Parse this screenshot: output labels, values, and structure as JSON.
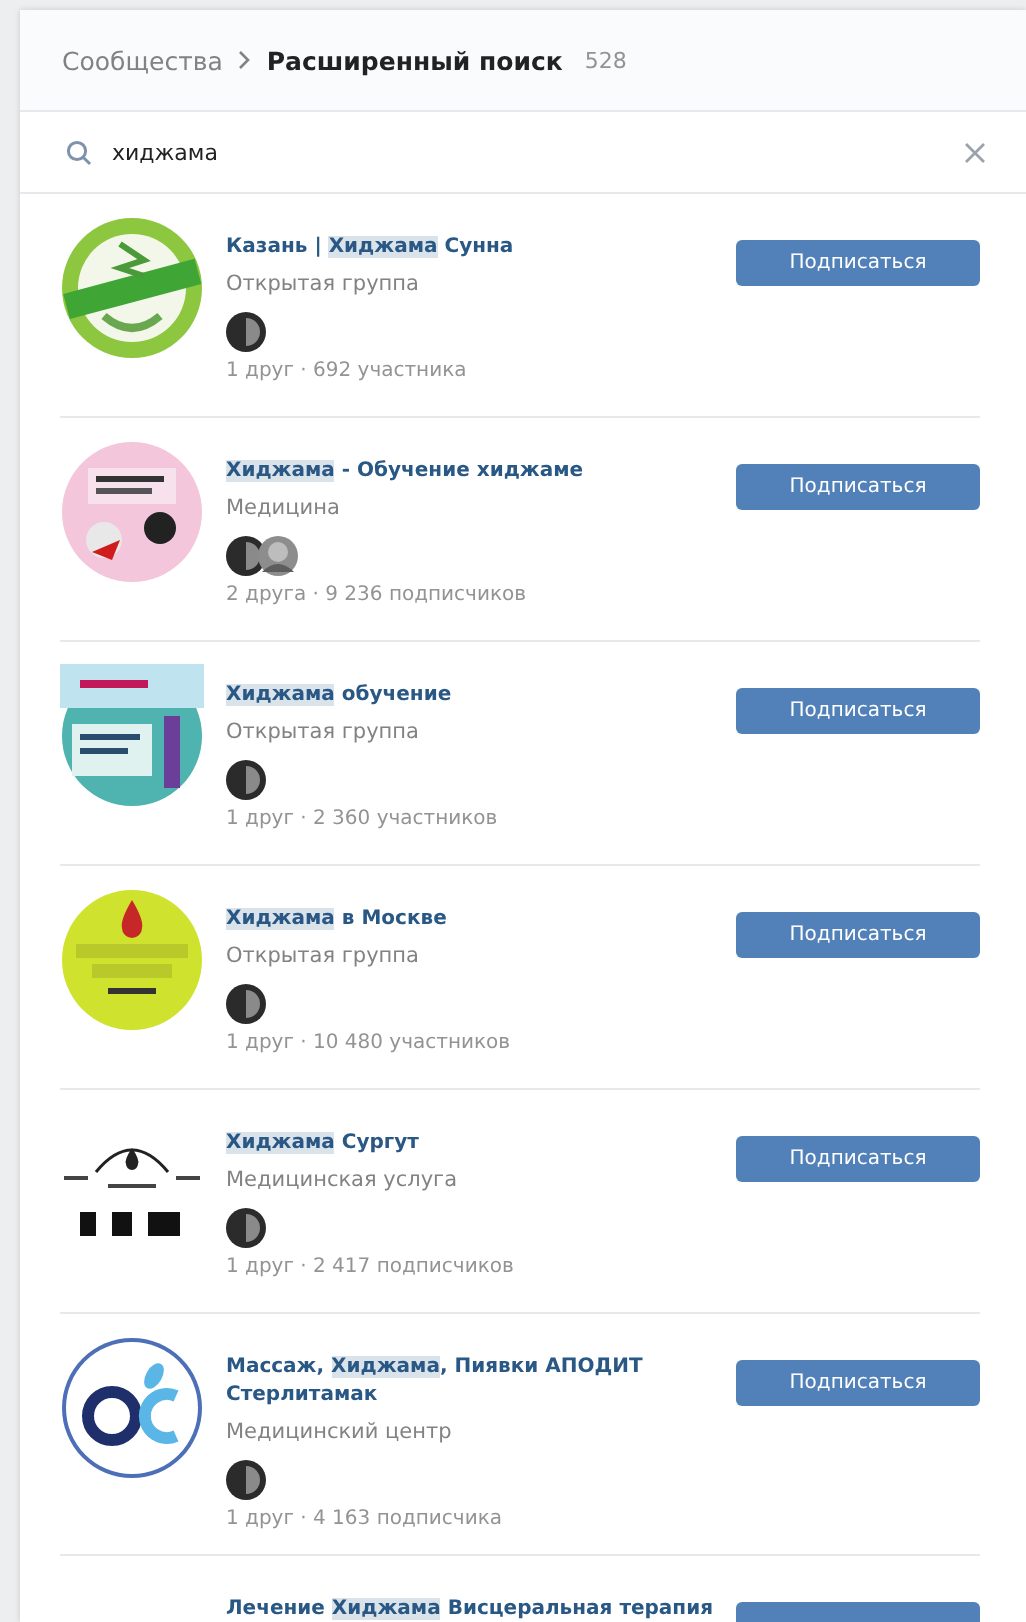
{
  "breadcrumb": {
    "parent": "Сообщества",
    "current": "Расширенный поиск",
    "count": "528"
  },
  "search": {
    "value": "хиджама"
  },
  "results": [
    {
      "title": [
        {
          "text": "Казань | "
        },
        {
          "text": "Хиджама",
          "highlight": true
        },
        {
          "text": " Сунна"
        }
      ],
      "category": "Открытая группа",
      "meta": "1 друг · 692 участника",
      "button": "Подписаться"
    },
    {
      "title": [
        {
          "text": "Хиджама",
          "highlight": true
        },
        {
          "text": " - Обучение хиджаме"
        }
      ],
      "category": "Медицина",
      "meta": "2 друга · 9 236 подписчиков",
      "button": "Подписаться"
    },
    {
      "title": [
        {
          "text": "Хиджама",
          "highlight": true
        },
        {
          "text": " обучение"
        }
      ],
      "category": "Открытая группа",
      "meta": "1 друг · 2 360 участников",
      "button": "Подписаться"
    },
    {
      "title": [
        {
          "text": "Хиджама",
          "highlight": true
        },
        {
          "text": " в Москве"
        }
      ],
      "category": "Открытая группа",
      "meta": "1 друг · 10 480 участников",
      "button": "Подписаться"
    },
    {
      "title": [
        {
          "text": "Хиджама",
          "highlight": true
        },
        {
          "text": " Сургут"
        }
      ],
      "category": "Медицинская услуга",
      "meta": "1 друг · 2 417 подписчиков",
      "button": "Подписаться"
    },
    {
      "title": [
        {
          "text": "Массаж, "
        },
        {
          "text": "Хиджама",
          "highlight": true
        },
        {
          "text": ", Пиявки АПОДИТ Стерлитамак"
        }
      ],
      "category": "Медицинский центр",
      "meta": "1 друг · 4 163 подписчика",
      "button": "Подписаться"
    },
    {
      "title": [
        {
          "text": "Лечение "
        },
        {
          "text": "Хиджама",
          "highlight": true
        },
        {
          "text": " Висцеральная терапия"
        }
      ]
    }
  ]
}
